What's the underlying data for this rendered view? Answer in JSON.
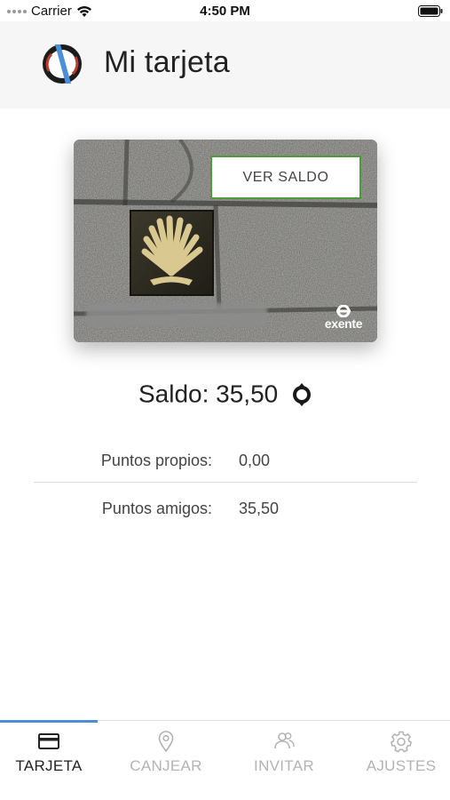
{
  "status_bar": {
    "carrier": "Carrier",
    "time": "4:50 PM"
  },
  "header": {
    "title": "Mi tarjeta"
  },
  "card": {
    "button_label": "VER SALDO",
    "brand": "exente"
  },
  "balance": {
    "label": "Saldo: 35,50"
  },
  "points": [
    {
      "label": "Puntos propios:",
      "value": "0,00"
    },
    {
      "label": "Puntos amigos:",
      "value": "35,50"
    }
  ],
  "tabs": [
    {
      "label": "TARJETA",
      "icon": "card-icon",
      "active": true
    },
    {
      "label": "CANJEAR",
      "icon": "location-pin-icon",
      "active": false
    },
    {
      "label": "INVITAR",
      "icon": "people-icon",
      "active": false
    },
    {
      "label": "AJUSTES",
      "icon": "gear-icon",
      "active": false
    }
  ],
  "colors": {
    "accent": "#4a90d9",
    "button_border": "#4f9a3a",
    "header_bg": "#f6f6f6",
    "inactive_tab": "#b3b3b3"
  }
}
